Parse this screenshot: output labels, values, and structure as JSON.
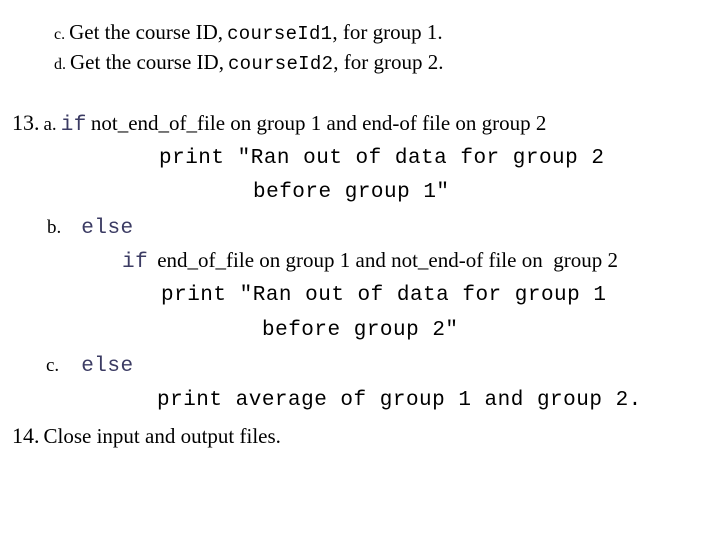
{
  "slide": {
    "background_color": "#ffffff",
    "keyword_color": "#3b3b63",
    "text_color": "#000000"
  },
  "items": {
    "item_12c": {
      "marker": "c.",
      "text_before": "Get the course ID,",
      "code": "courseId1",
      "text_after": ", for group 1."
    },
    "item_12d": {
      "marker": "d.",
      "text_before": "Get the course ID,",
      "code": "courseId2",
      "text_after": ", for group 2."
    },
    "item_13": {
      "number": "13.",
      "a": {
        "marker": "a.",
        "keyword": "if",
        "condition": "not_end_of_file on group 1 and end-of file on group 2",
        "print_line_1": "print \"Ran out of data for group 2",
        "print_line_2": "before group 1\""
      },
      "b": {
        "marker": "b.",
        "keyword": "else",
        "keyword_if": "if",
        "condition": "end_of_file on group 1 and not_end-of file on  group 2",
        "print_line_1": "print \"Ran out of data for group 1",
        "print_line_2": "before group 2\""
      },
      "c": {
        "marker": "c.",
        "keyword": "else",
        "print_line_1": "print average of group 1 and group 2."
      }
    },
    "item_14": {
      "number": "14.",
      "text": "Close input and output files."
    }
  }
}
